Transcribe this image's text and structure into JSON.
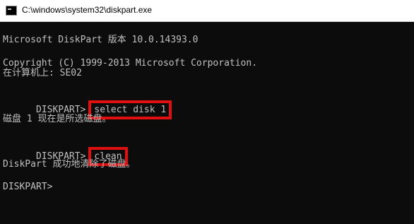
{
  "window": {
    "title": "C:\\windows\\system32\\diskpart.exe"
  },
  "console": {
    "lines": [
      "Microsoft DiskPart 版本 10.0.14393.0",
      "Copyright (C) 1999-2013 Microsoft Corporation.",
      "在计算机上: SE02",
      "磁盘 1 现在是所选磁盘。",
      "DiskPart 成功地清除了磁盘。",
      "DISKPART>"
    ],
    "prompt": "DISKPART>",
    "commands": [
      "select disk 1",
      "clean"
    ]
  },
  "colors": {
    "console_background": "#0c0c0c",
    "console_text": "#c0c0c0",
    "highlight_box": "#e01010"
  }
}
